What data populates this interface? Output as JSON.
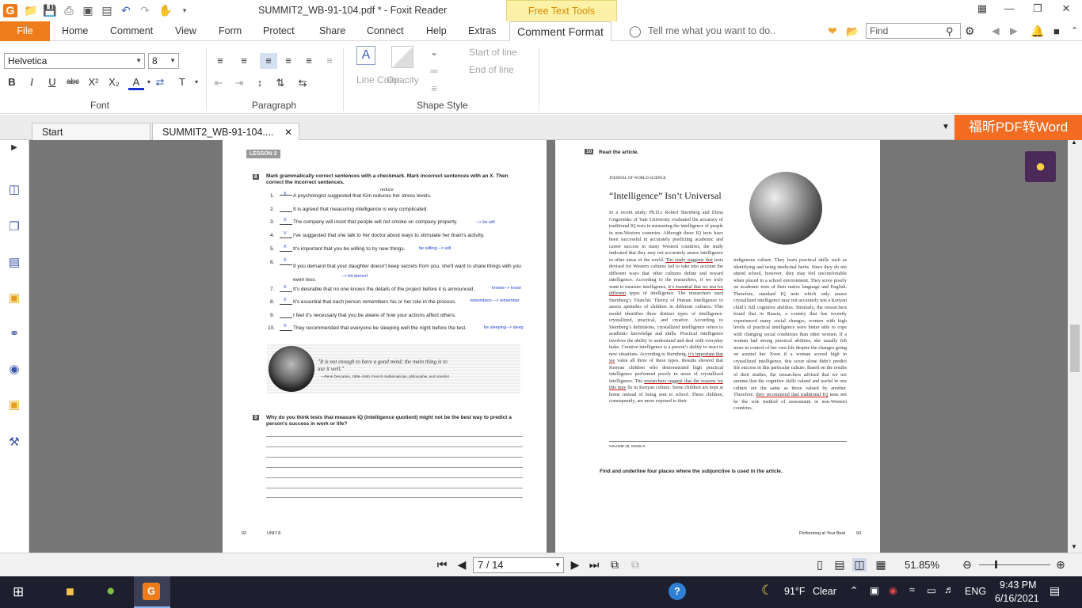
{
  "window": {
    "title": "SUMMIT2_WB-91-104.pdf * - Foxit Reader",
    "context_tab": "Free Text Tools"
  },
  "menu": {
    "file": "File",
    "tabs": [
      "Home",
      "Comment",
      "View",
      "Form",
      "Protect",
      "Share",
      "Connect",
      "Help",
      "Extras"
    ],
    "active_tab": "Comment Format",
    "tell_me": "Tell me what you want to do..",
    "find_placeholder": "Find"
  },
  "ribbon": {
    "font_name": "Helvetica",
    "font_size": "8",
    "groups": {
      "font": "Font",
      "paragraph": "Paragraph",
      "shape_style": "Shape Style"
    },
    "line_color": "Line Color",
    "opacity": "Opacity",
    "start_of_line": "Start of line",
    "end_of_line": "End of line"
  },
  "tabs": {
    "start": "Start",
    "doc": "SUMMIT2_WB-91-104....",
    "promo": "福昕PDF转Word"
  },
  "left_page": {
    "lesson": "LESSON 2",
    "ex8_num": "8",
    "ex8_title": "Mark grammatically correct sentences with a checkmark. Mark incorrect sentences with an X. Then correct the incorrect sentences.",
    "items": [
      {
        "n": "1.",
        "mark": "X",
        "text": "A psychologist suggested that Kim reduces her stress levels.",
        "fix": "reduce"
      },
      {
        "n": "2.",
        "mark": "",
        "text": "It is agreed that measuring intelligence is very complicated.",
        "fix": ""
      },
      {
        "n": "3.",
        "mark": "X",
        "text": "The company will insist that people will not smoke on company property.",
        "fix": "--> be will"
      },
      {
        "n": "4.",
        "mark": "V",
        "text": "I've suggested that she talk to her doctor about ways to stimulate her brain's activity.",
        "fix": ""
      },
      {
        "n": "5.",
        "mark": "X",
        "text": "It's important that you be willing to try new things.",
        "fix": "be willing --> will"
      },
      {
        "n": "6.",
        "mark": "X",
        "text": "If you demand that your daughter doesn't keep secrets from you, she'll want to share things with you even less.",
        "fix": "--> bô doesn't"
      },
      {
        "n": "7.",
        "mark": "X",
        "text": "It's desirable that no one knows the details of the project before it is announced.",
        "fix": "knows--> know"
      },
      {
        "n": "8.",
        "mark": "X",
        "text": "It's essential that each person remembers his or her role in the process.",
        "fix": "remembers --> remember"
      },
      {
        "n": "9.",
        "mark": "",
        "text": "I feel it's necessary that you be aware of how your actions affect others.",
        "fix": ""
      },
      {
        "n": "10.",
        "mark": "X",
        "text": "They recommended that everyone be sleeping well the night before the test.",
        "fix": "be sleeping--> sleep"
      }
    ],
    "quote": "\"It is not enough to have a good mind; the main thing is to use it well.\"",
    "quote_author": "—René Descartes, 1596–1650, French mathematician, philosopher, and scientist",
    "ex9_num": "9",
    "ex9_title": "Why do you think tests that measure IQ (intelligence quotient) might not be the best way to predict a person's success in work or life?",
    "footer_page": "92",
    "footer_unit": "UNIT 8"
  },
  "right_page": {
    "ex10_num": "10",
    "ex10_title": "Read the article.",
    "journal": "JOURNAL OF WORLD SCIENCE",
    "headline": "“Intelligence” Isn’t Universal",
    "col1": "In a recent study, Ph.D.s Robert Sternberg and Elena Grigorenko of Yale University evaluated the accuracy of traditional IQ tests in measuring the intelligence of people in non-Western countries. Although these IQ tests have been successful in accurately predicting academic and career success in many Western countries, the study indicated that they may not accurately assess intelligence in other areas of the world.",
    "u1": "The study suggests that",
    "col1b": "tests devised for Western cultures fail to take into account the different ways that other cultures define and reward intelligence. According to the researchers, if we truly want to measure intelligence,",
    "u2": "it’s essential that we test for different",
    "col1c": "types of intelligence. The researchers used Sternberg’s Triarchic Theory of Human Intelligence to assess aptitudes of children in different cultures. This model identifies three distinct types of intelligence: crystallized, practical, and creative. According to Sternberg’s definitions, crystallized intelligence refers to academic knowledge and skills. Practical intelligence involves the ability to understand and deal with everyday tasks. Creative intelligence is a person’s ability to react to new situations. According to Sternberg,",
    "u3": "it’s important that we",
    "col1d": "value all three of these types. Results showed that Kenyan children who demonstrated high practical intelligence performed poorly in areas of crystallized intelligence. The",
    "u4": "researchers suggest that the reasons for this may",
    "col1e": "lie in Kenyan culture. Some children are kept at home instead of being sent to school. These children, consequently, are more exposed to their",
    "col2": "indigenous culture. They learn practical skills such as identifying and using medicinal herbs. Since they do not attend school, however, they may feel uncomfortable when placed in a school environment. They score poorly on academic tests of their native language and English. Therefore, standard IQ tests which only assess crystallized intelligence may not accurately test a Kenyan child’s full cognitive abilities. Similarly, the researchers found that in Russia, a country that has recently experienced many social changes, women with high levels of practical intelligence were better able to cope with changing social conditions than other women. If a woman had strong practical abilities, she usually felt more in control of her own life despite the changes going on around her. Even if a woman scored high in crystallized intelligence, this score alone didn’t predict life success in this particular culture. Based on the results of their studies, the researchers advised that we not assume that the cognitive skills valued and useful in one culture are the same as those valued by another. Therefore,",
    "u5": "they recommend that traditional IQ",
    "col2b": "tests not be the sole method of assessment in non-Western countries.",
    "volume": "VOLUME 28, ISSUE 6",
    "instruction": "Find and underline four places where the subjunctive is used in the article.",
    "footer_title": "Performing at Your Best",
    "footer_page": "93"
  },
  "status": {
    "page": "7 / 14",
    "zoom": "51.85%"
  },
  "taskbar": {
    "weather_temp": "91°F",
    "weather_desc": "Clear",
    "lang": "ENG",
    "time": "9:43 PM",
    "date": "6/16/2021"
  }
}
